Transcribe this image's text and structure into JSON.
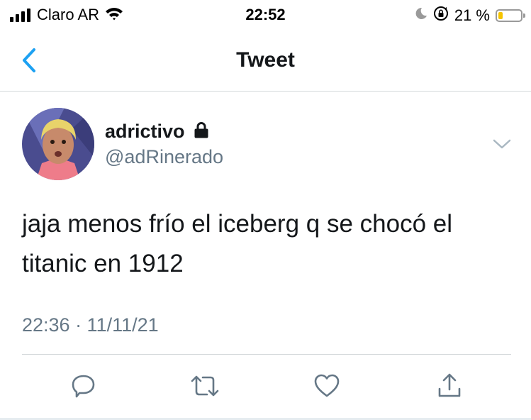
{
  "status_bar": {
    "carrier": "Claro AR",
    "time": "22:52",
    "battery_percent": "21 %",
    "battery_level": 0.21,
    "battery_color": "#f5c400",
    "icons": [
      "signal-icon",
      "wifi-icon",
      "moon-icon",
      "rotation-lock-icon",
      "battery-icon"
    ]
  },
  "nav": {
    "title": "Tweet",
    "back_icon": "chevron-left-icon",
    "accent": "#1da1f2"
  },
  "tweet": {
    "display_name": "adrictivo",
    "handle": "@adRinerado",
    "protected": true,
    "text": "jaja menos frío el iceberg q se chocó el titanic en 1912",
    "timestamp": "22:36 · 11/11/21",
    "text_color": "#14171a",
    "secondary_color": "#657786"
  },
  "actions": [
    {
      "name": "reply",
      "icon": "reply-icon"
    },
    {
      "name": "retweet",
      "icon": "retweet-icon"
    },
    {
      "name": "like",
      "icon": "heart-icon"
    },
    {
      "name": "share",
      "icon": "share-icon"
    }
  ]
}
